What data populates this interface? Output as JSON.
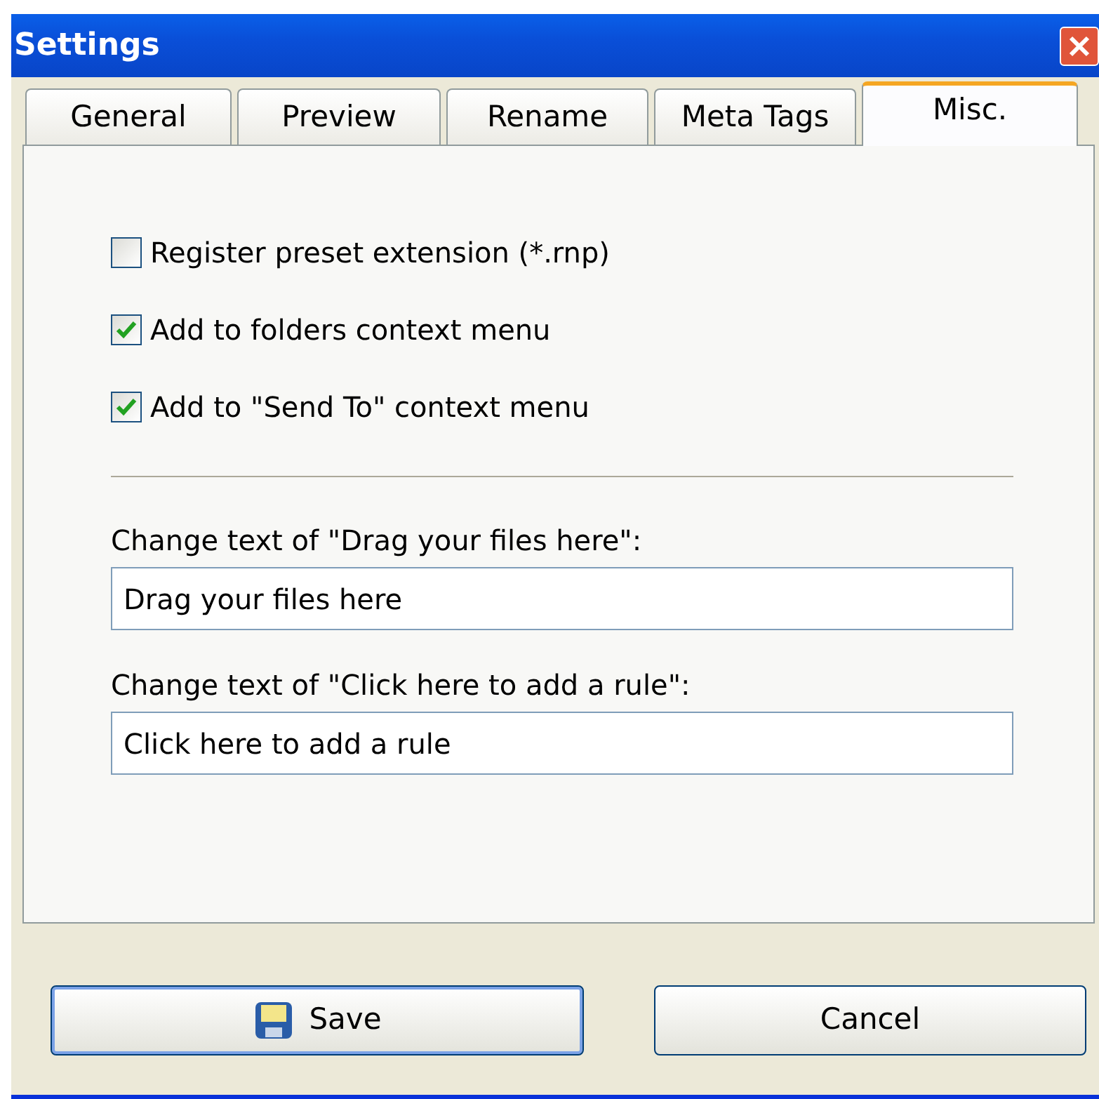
{
  "window": {
    "title": "Settings"
  },
  "tabs": [
    {
      "label": "General",
      "selected": false
    },
    {
      "label": "Preview",
      "selected": false
    },
    {
      "label": "Rename",
      "selected": false
    },
    {
      "label": "Meta Tags",
      "selected": false
    },
    {
      "label": "Misc.",
      "selected": true
    }
  ],
  "options": [
    {
      "label": "Register preset extension (*.rnp)",
      "checked": false
    },
    {
      "label": "Add to folders context menu",
      "checked": true
    },
    {
      "label": "Add to \"Send To\" context menu",
      "checked": true
    }
  ],
  "fields": [
    {
      "label": "Change text of \"Drag your files here\":",
      "value": "Drag your files here"
    },
    {
      "label": "Change text of \"Click here to add a rule\":",
      "value": "Click here to add a rule"
    }
  ],
  "buttons": [
    {
      "label": "Save",
      "kind": "save"
    },
    {
      "label": "Cancel",
      "kind": "plain"
    }
  ]
}
